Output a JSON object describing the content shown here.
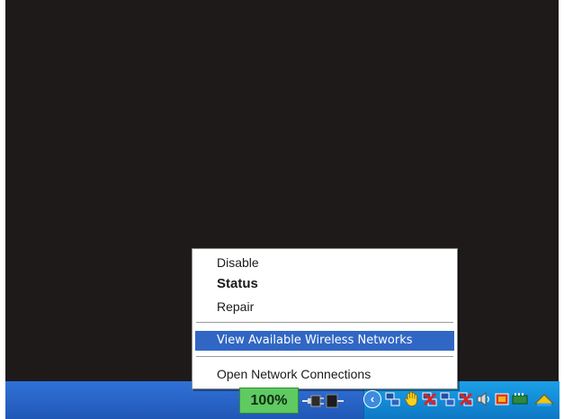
{
  "context_menu": {
    "items": [
      {
        "label": "Disable"
      },
      {
        "label": "Status"
      },
      {
        "label": "Repair"
      },
      {
        "label": "View Available Wireless Networks"
      },
      {
        "label": "Open Network Connections"
      }
    ],
    "highlighted_item": "View Available Wireless Networks"
  },
  "tray": {
    "battery_label": "100%",
    "icons": [
      "power-plug-icon",
      "show-hidden-icons-chevron",
      "network-connection-icon",
      "hand-icon",
      "network-disconnected-icon",
      "network-connection-icon",
      "network-disconnected-icon",
      "speaker-icon",
      "network-adapter-icon",
      "safely-remove-hardware-icon"
    ]
  },
  "colors": {
    "desktop": "#1e1a19",
    "taskbar": "#2a66c9",
    "tray": "#128bd7",
    "menu_highlight": "#3167c4",
    "battery_badge": "#5fca61"
  }
}
